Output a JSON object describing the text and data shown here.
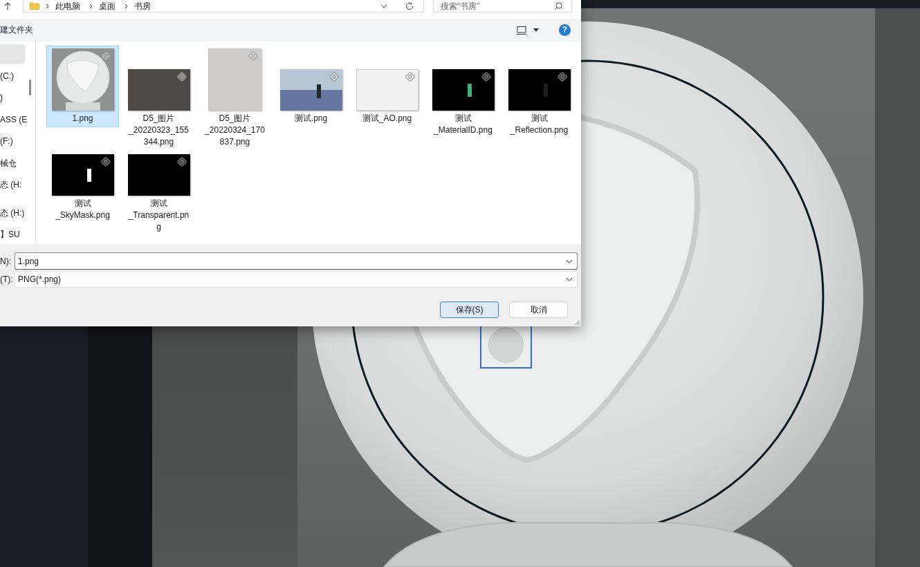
{
  "dialog": {
    "address_bar": {
      "path": [
        "此电脑",
        "桌面",
        "书房"
      ]
    },
    "search": {
      "placeholder": "搜索“书房”"
    },
    "toolbar": {
      "new_folder": "建文件夹",
      "help": "?"
    },
    "sidebar": {
      "items": [
        {
          "selected": true
        },
        {
          "label": "(C:)",
          "selected": false
        },
        {
          "label": ")",
          "selected": false
        },
        {
          "label": "ASS (E",
          "selected": false
        },
        {
          "label": "(F:)",
          "selected": false
        },
        {
          "label": "械仓",
          "selected": false
        },
        {
          "label": "态 (H:",
          "selected": false
        },
        {
          "label": "态 (H:)",
          "selected": false
        },
        {
          "label": "】SU",
          "selected": false
        }
      ]
    },
    "files": [
      {
        "name": "1.png",
        "kind": "sphere",
        "selected": true
      },
      {
        "name": "D5_图片_20220323_155344.png",
        "kind": "photo-wide",
        "selected": false
      },
      {
        "name": "D5_图片_20220324_170837.png",
        "kind": "photo-tall",
        "selected": false
      },
      {
        "name": "测试.png",
        "kind": "scene",
        "selected": false
      },
      {
        "name": "测试_AO.png",
        "kind": "blank",
        "selected": false
      },
      {
        "name": "测试_MaterialID.png",
        "kind": "id-mask",
        "selected": false
      },
      {
        "name": "测试_Reflection.png",
        "kind": "reflection-mask",
        "selected": false
      },
      {
        "name": "测试_SkyMask.png",
        "kind": "sky-mask",
        "selected": false
      },
      {
        "name": "测试_Transparent.png",
        "kind": "empty-mask",
        "selected": false
      }
    ],
    "file_name": {
      "label": "N):",
      "value": "1.png"
    },
    "file_type": {
      "label": "(T):",
      "value": "PNG(*.png)"
    },
    "buttons": [
      {
        "label": "保存(S)",
        "kind": "default"
      },
      {
        "label": "取消",
        "kind": "normal"
      }
    ]
  }
}
